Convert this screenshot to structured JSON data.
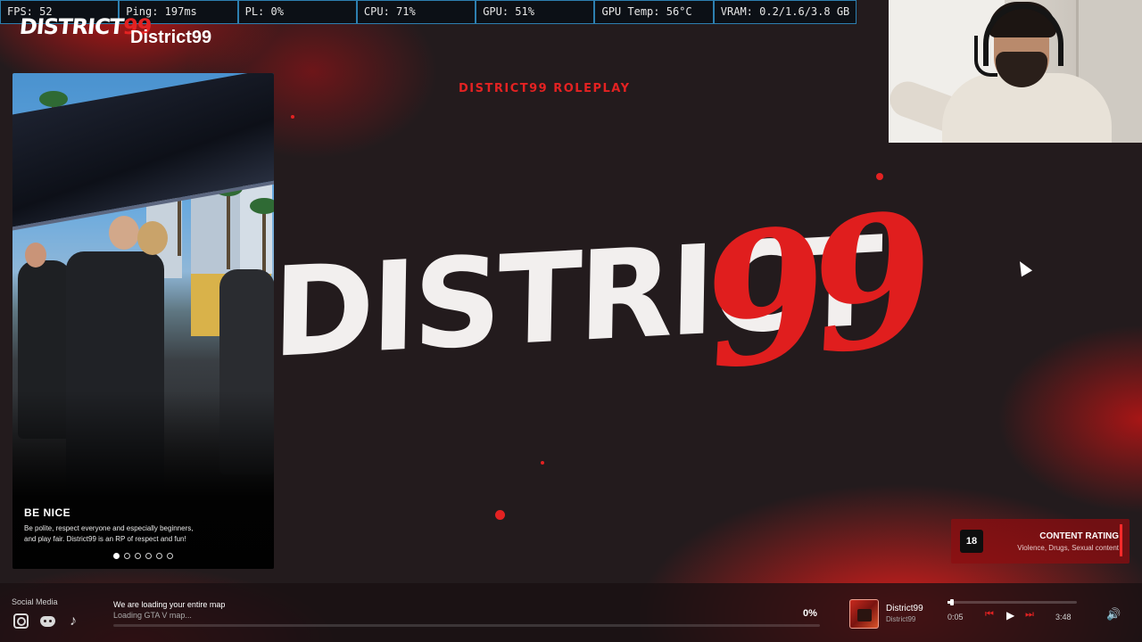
{
  "stats": {
    "fps": "FPS: 52",
    "ping": "Ping: 197ms",
    "pl": "PL: 0%",
    "cpu": "CPU: 71%",
    "gpu": "GPU: 51%",
    "gpu_temp": "GPU Temp: 56°C",
    "vram": "VRAM: 0.2/1.6/3.8 GB"
  },
  "header": {
    "logo_text": "DISTRICT",
    "logo_num": "99",
    "server_name": "District99"
  },
  "hero": {
    "tagline": "DISTRICT99 ROLEPLAY",
    "logo_word": "DISTRICT",
    "logo_number": "99"
  },
  "card": {
    "title": "BE NICE",
    "description": "Be polite, respect everyone and especially beginners, and play fair. District99 is an RP of respect and fun!",
    "slides_total": 6,
    "active_slide": 1
  },
  "content_rating": {
    "age": "18",
    "title": "CONTENT RATING",
    "descriptors": "Violence, Drugs, Sexual content"
  },
  "footer": {
    "social_label": "Social Media",
    "social_icons": [
      "instagram-icon",
      "discord-icon",
      "tiktok-icon"
    ],
    "loading_title": "We are loading your entire map",
    "loading_subtitle": "Loading GTA V map...",
    "loading_percent": "0%",
    "loading_progress": 0
  },
  "player": {
    "track_title": "District99",
    "track_artist": "District99",
    "current_time": "0:05",
    "total_time": "3:48",
    "progress": 0.023
  },
  "colors": {
    "accent": "#e32222",
    "stats_border": "#2d7fb0"
  }
}
